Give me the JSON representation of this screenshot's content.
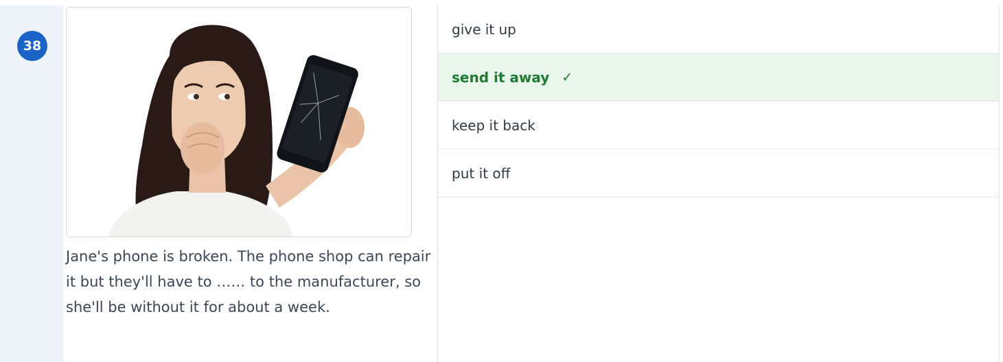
{
  "question": {
    "number": "38",
    "text": "Jane's phone is broken. The phone shop can repair it but they'll have to …… to the manufacturer, so she'll be without it for about a week.",
    "image": "woman-holding-broken-phone"
  },
  "options": [
    {
      "label": "give it up",
      "state": "default"
    },
    {
      "label": "send it away",
      "state": "correct"
    },
    {
      "label": "keep it back",
      "state": "default"
    },
    {
      "label": "put it off",
      "state": "default"
    }
  ],
  "correct_icon": "✓",
  "colors": {
    "badge": "#1a64c8",
    "correct_bg": "#e7f5ea",
    "correct_text": "#1f7a34",
    "gutter": "#eef3fa"
  }
}
